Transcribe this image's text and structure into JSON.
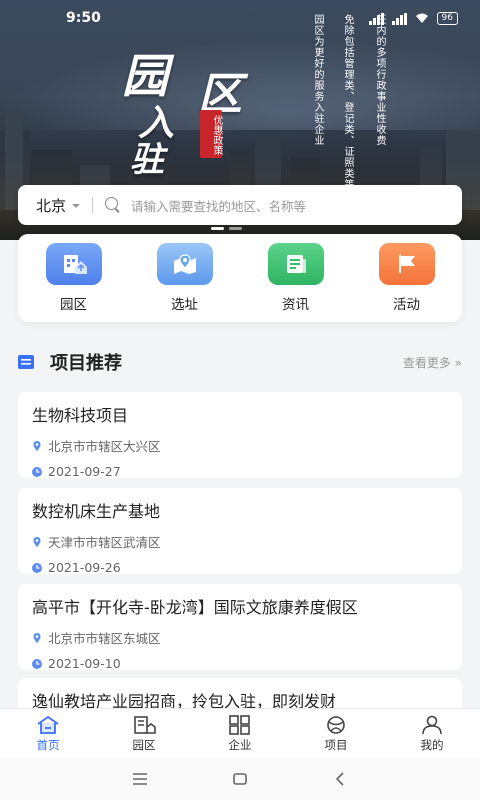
{
  "status": {
    "time": "9:50",
    "battery": "96"
  },
  "hero": {
    "title_chars": [
      "园",
      "区",
      "入",
      "驻"
    ],
    "seal": "优惠政策",
    "vertical_text": [
      "任内的多项行政事业性收费",
      "免除包括管理类、登记类、证照类等",
      "园区为更好的服务入驻企业"
    ]
  },
  "search": {
    "city": "北京",
    "placeholder": "请输入需要查找的地区、名称等"
  },
  "categories": [
    {
      "label": "园区",
      "icon": "park-building-icon",
      "color": "#5b8ef0"
    },
    {
      "label": "选址",
      "icon": "location-map-icon",
      "color": "#6aa6ee"
    },
    {
      "label": "资讯",
      "icon": "news-document-icon",
      "color": "#35c06a"
    },
    {
      "label": "活动",
      "icon": "flag-icon",
      "color": "#f7824a"
    }
  ],
  "section": {
    "title": "项目推荐",
    "more": "查看更多 »"
  },
  "projects": [
    {
      "title": "生物科技项目",
      "location": "北京市市辖区大兴区",
      "date": "2021-09-27"
    },
    {
      "title": "数控机床生产基地",
      "location": "天津市市辖区武清区",
      "date": "2021-09-26"
    },
    {
      "title": "高平市【开化寺-卧龙湾】国际文旅康养度假区",
      "location": "北京市市辖区东城区",
      "date": "2021-09-10"
    },
    {
      "title": "逸仙教培产业园招商，拎包入驻，即刻发财",
      "location": "",
      "date": ""
    }
  ],
  "tabs": [
    {
      "label": "首页",
      "icon": "home-icon",
      "active": true
    },
    {
      "label": "园区",
      "icon": "park-icon",
      "active": false
    },
    {
      "label": "企业",
      "icon": "enterprise-grid-icon",
      "active": false
    },
    {
      "label": "项目",
      "icon": "project-icon",
      "active": false
    },
    {
      "label": "我的",
      "icon": "user-icon",
      "active": false
    }
  ],
  "colors": {
    "accent": "#3a6ff7",
    "page_bg": "#f3f4f6"
  }
}
